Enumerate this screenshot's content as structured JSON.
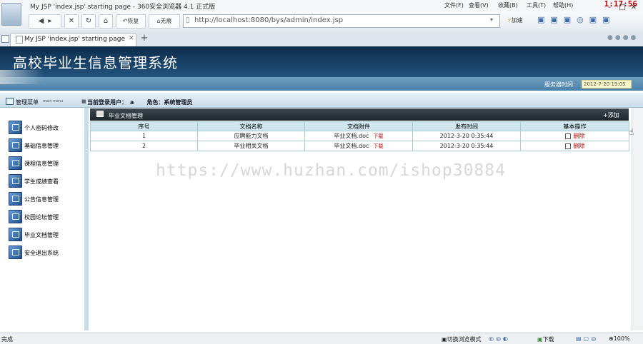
{
  "browser": {
    "window_title": "My JSP 'index.jsp' starting page - 360安全浏览器 4.1 正式版",
    "menu": [
      "文件(F)",
      "查看(V)",
      "收藏(B)",
      "工具(T)",
      "帮助(H)"
    ],
    "clock": "1:17:56",
    "window_controls": [
      "-",
      "□",
      "✕"
    ],
    "nav": {
      "back_icon": "back-arrow-icon",
      "restore_label": "恢复",
      "no_trace_label": "无痕"
    },
    "address": "http://localhost:8080/bys/admin/index.jsp",
    "speed_label": "加速",
    "tab_label": "My JSP 'index.jsp' starting page",
    "tab_close": "✕",
    "new_tab": "+"
  },
  "app": {
    "title": "高校毕业生信息管理系统",
    "server_time_label": "服务器时间:",
    "server_time": "2012-7-20 19:05",
    "menu_title": "管理菜单",
    "menu_subtitle": "main menu",
    "user_label": "当前登录用户：",
    "user_name": "a",
    "role_label": "角色：",
    "role": "系统管理员"
  },
  "sidebar": {
    "items": [
      {
        "label": "个人密码修改"
      },
      {
        "label": "基础信息管理"
      },
      {
        "label": "课程信息管理"
      },
      {
        "label": "学生成绩查看"
      },
      {
        "label": "公告信息管理"
      },
      {
        "label": "校园论坛管理"
      },
      {
        "label": "毕业文档管理"
      },
      {
        "label": "安全退出系统"
      }
    ]
  },
  "panel": {
    "title": "毕业文档管理",
    "add_label": "+添加",
    "columns": [
      "序号",
      "文档名称",
      "文档附件",
      "发布时间",
      "基本操作"
    ],
    "rows": [
      {
        "no": "1",
        "name": "应聘能力文档",
        "file": "毕业文档.doc",
        "download": "下载",
        "time": "2012-3-20 0:35:44",
        "action": "删除"
      },
      {
        "no": "2",
        "name": "毕业相关文档",
        "file": "毕业文档.doc",
        "download": "下载",
        "time": "2012-3-20 0:35:44",
        "action": "删除"
      }
    ]
  },
  "watermark": "https://www.huzhan.com/ishop30884",
  "status": {
    "left": "完成",
    "mode": "切换浏览模式",
    "download": "下载",
    "zoom": "100%"
  },
  "colors": {
    "header_dark": "#0d2c4a",
    "header_band": "#4c81a6",
    "panel_head": "#1d262c",
    "table_header": "#cfe6ef",
    "danger": "#c00000"
  }
}
